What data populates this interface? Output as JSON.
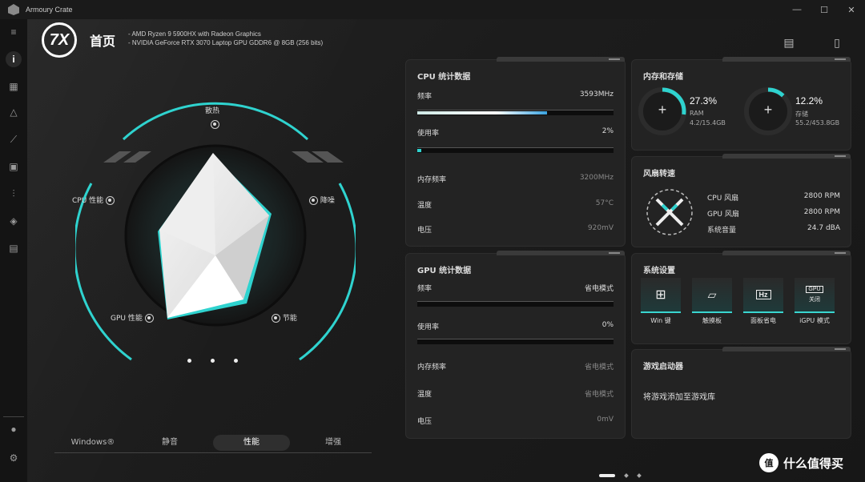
{
  "app": {
    "title": "Armoury Crate"
  },
  "window_controls": {
    "minimize": "—",
    "maximize": "☐",
    "close": "✕"
  },
  "header": {
    "page_title": "首页",
    "spec_lines": [
      "-   AMD Ryzen 9 5900HX with Radeon Graphics",
      "-   NVIDIA GeForce RTX 3070 Laptop GPU GDDR6 @ 8GB (256 bits)"
    ]
  },
  "radar": {
    "labels": {
      "top": "散热",
      "left": "CPU 性能",
      "right": "降噪",
      "bottom_left": "GPU 性能",
      "bottom_right": "节能"
    }
  },
  "modes": {
    "items": [
      "Windows®",
      "静音",
      "性能",
      "增强"
    ],
    "active": "性能"
  },
  "cpu_panel": {
    "title": "CPU 统计数据",
    "rows": [
      {
        "label": "频率",
        "value": "3593MHz"
      },
      {
        "label": "使用率",
        "value": "2%"
      },
      {
        "label": "内存频率",
        "value": "3200MHz"
      },
      {
        "label": "温度",
        "value": "57°C"
      },
      {
        "label": "电压",
        "value": "920mV"
      }
    ],
    "freq_fill_percent": 66,
    "usage_fill_percent": 2
  },
  "gpu_panel": {
    "title": "GPU 统计数据",
    "rows": [
      {
        "label": "频率",
        "value": "省电模式"
      },
      {
        "label": "使用率",
        "value": "0%"
      },
      {
        "label": "内存频率",
        "value": "省电模式"
      },
      {
        "label": "温度",
        "value": "省电模式"
      },
      {
        "label": "电压",
        "value": "0mV"
      }
    ]
  },
  "memory_panel": {
    "title": "内存和存储",
    "ram": {
      "percent": "27.3%",
      "label": "RAM",
      "detail": "4.2/15.4GB",
      "fill": 0.273
    },
    "storage": {
      "percent": "12.2%",
      "label": "存储",
      "detail": "55.2/453.8GB",
      "fill": 0.122
    }
  },
  "fan_panel": {
    "title": "风扇转速",
    "rows": [
      {
        "label": "CPU 风扇",
        "value": "2800 RPM"
      },
      {
        "label": "GPU 风扇",
        "value": "2800 RPM"
      },
      {
        "label": "系统音量",
        "value": "24.7 dBA"
      }
    ]
  },
  "system_panel": {
    "title": "系统设置",
    "buttons": [
      {
        "label": "Win 键",
        "icon": "windows-key-icon"
      },
      {
        "label": "触摸板",
        "icon": "touchpad-icon"
      },
      {
        "label": "面板省电",
        "icon": "panel-hz-icon",
        "glyph": "Hz"
      },
      {
        "label": "iGPU 模式",
        "icon": "gpu-icon",
        "glyph": "GPU",
        "status": "关闭"
      }
    ]
  },
  "game_panel": {
    "title": "游戏启动器",
    "message": "将游戏添加至游戏库"
  },
  "watermark": {
    "text": "什么值得买",
    "logo": "值"
  },
  "colors": {
    "accent": "#2fd3cf",
    "bg": "#1c1c1c"
  }
}
